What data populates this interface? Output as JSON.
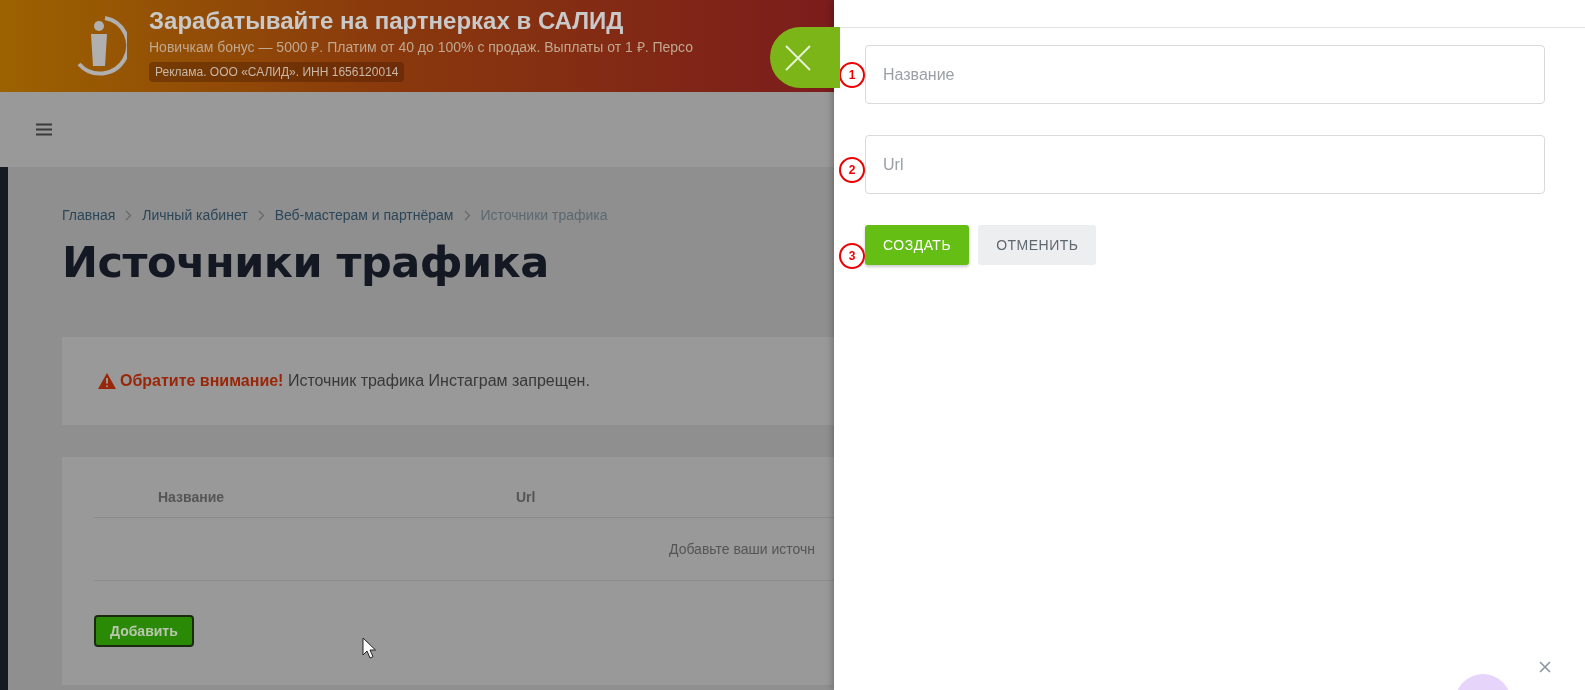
{
  "ad": {
    "title": "Зарабатывайте на партнерках в САЛИД",
    "subtitle": "Новичкам бонус — 5000 ₽. Платим от 40 до 100% с продаж. Выплаты от 1 ₽. Персо",
    "label": "Реклама. ООО «САЛИД». ИНН 1656120014"
  },
  "breadcrumbs": [
    {
      "label": "Главная",
      "current": false
    },
    {
      "label": "Личный кабинет",
      "current": false
    },
    {
      "label": "Веб-мастерам и партнёрам",
      "current": false
    },
    {
      "label": "Источники трафика",
      "current": true
    }
  ],
  "page_title": "Источники трафика",
  "notice": "**Обратите внимание!** Источник трафика Инстаграм запрещен.",
  "table": {
    "columns": [
      "Название",
      "Url"
    ],
    "empty_message": "Добавьте ваши источн"
  },
  "add_button": "Добавить",
  "drawer": {
    "fields": [
      {
        "placeholder": "Название",
        "marker": "1"
      },
      {
        "placeholder": "Url",
        "marker": "2"
      }
    ],
    "buttons": [
      {
        "label": "СОЗДАТЬ",
        "kind": "primary"
      },
      {
        "label": "ОТМЕНИТЬ",
        "kind": "secondary"
      }
    ],
    "buttons_marker": "3"
  }
}
